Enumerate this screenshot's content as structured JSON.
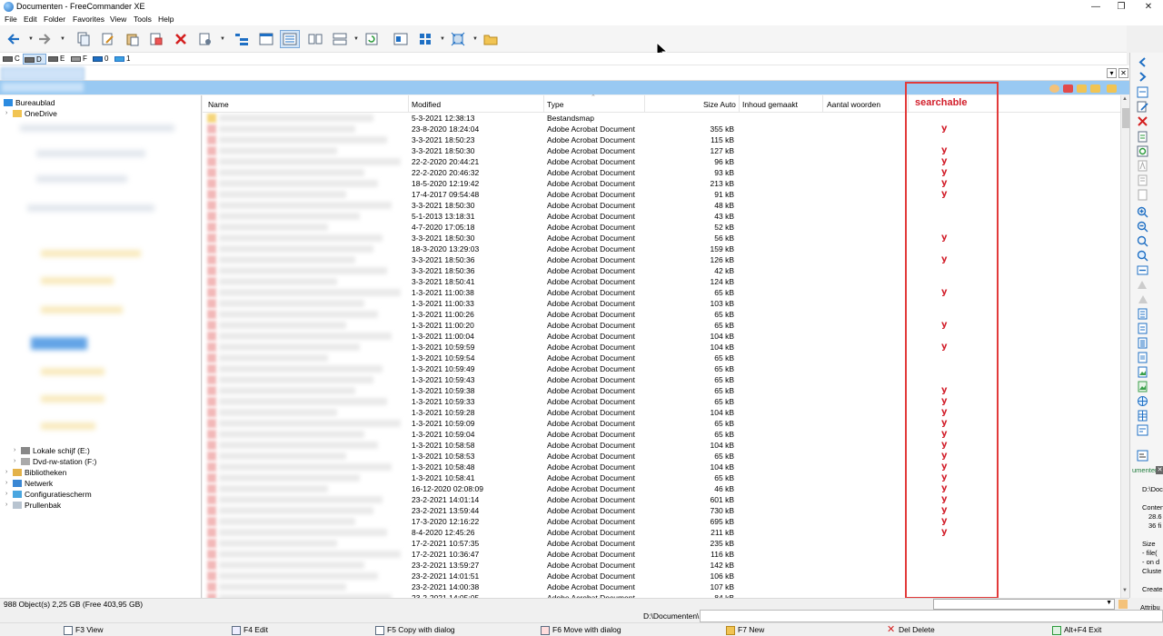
{
  "window": {
    "title": "Documenten - FreeCommander XE",
    "controls": [
      "—",
      "❐",
      "✕"
    ]
  },
  "menu": [
    "File",
    "Edit",
    "Folder",
    "Favorites",
    "View",
    "Tools",
    "Help"
  ],
  "drives": [
    {
      "label": "C",
      "selected": false
    },
    {
      "label": "D",
      "selected": true
    },
    {
      "label": "E",
      "selected": false
    },
    {
      "label": "F",
      "selected": false
    },
    {
      "label": "0",
      "selected": false
    },
    {
      "label": "1",
      "selected": false
    }
  ],
  "tree": {
    "top": [
      {
        "label": "Bureaublad",
        "icon": "desktop-icon"
      },
      {
        "label": "OneDrive",
        "icon": "folder-icon"
      }
    ],
    "bottom": [
      {
        "label": "Lokale schijf (E:)",
        "icon": "drive-icon"
      },
      {
        "label": "Dvd-rw-station (F:)",
        "icon": "dvd-drive-icon"
      },
      {
        "label": "Bibliotheken",
        "icon": "library-icon"
      },
      {
        "label": "Netwerk",
        "icon": "network-icon"
      },
      {
        "label": "Configuratiescherm",
        "icon": "control-panel-icon"
      },
      {
        "label": "Prullenbak",
        "icon": "recycle-bin-icon"
      }
    ]
  },
  "columns": {
    "name": "Name",
    "modified": "Modified",
    "type": "Type",
    "size": "Size Auto",
    "content_created": "Inhoud gemaakt",
    "word_count": "Aantal woorden"
  },
  "annotation": {
    "label": "searchable",
    "mark": "y",
    "color": "#d21f2b"
  },
  "files": [
    {
      "modified": "5-3-2021 12:38:13",
      "type": "Bestandsmap",
      "size": "",
      "folder": true,
      "searchable": false
    },
    {
      "modified": "23-8-2020 18:24:04",
      "type": "Adobe Acrobat Document",
      "size": "355 kB",
      "searchable": true
    },
    {
      "modified": "3-3-2021 18:50:23",
      "type": "Adobe Acrobat Document",
      "size": "115 kB",
      "searchable": false
    },
    {
      "modified": "3-3-2021 18:50:30",
      "type": "Adobe Acrobat Document",
      "size": "127 kB",
      "searchable": true
    },
    {
      "modified": "22-2-2020 20:44:21",
      "type": "Adobe Acrobat Document",
      "size": "96 kB",
      "searchable": true
    },
    {
      "modified": "22-2-2020 20:46:32",
      "type": "Adobe Acrobat Document",
      "size": "93 kB",
      "searchable": true
    },
    {
      "modified": "18-5-2020 12:19:42",
      "type": "Adobe Acrobat Document",
      "size": "213 kB",
      "searchable": true
    },
    {
      "modified": "17-4-2017 09:54:48",
      "type": "Adobe Acrobat Document",
      "size": "91 kB",
      "searchable": true
    },
    {
      "modified": "3-3-2021 18:50:30",
      "type": "Adobe Acrobat Document",
      "size": "48 kB",
      "searchable": false
    },
    {
      "modified": "5-1-2013 13:18:31",
      "type": "Adobe Acrobat Document",
      "size": "43 kB",
      "searchable": false
    },
    {
      "modified": "4-7-2020 17:05:18",
      "type": "Adobe Acrobat Document",
      "size": "52 kB",
      "searchable": false
    },
    {
      "modified": "3-3-2021 18:50:30",
      "type": "Adobe Acrobat Document",
      "size": "56 kB",
      "searchable": true
    },
    {
      "modified": "18-3-2020 13:29:03",
      "type": "Adobe Acrobat Document",
      "size": "159 kB",
      "searchable": false
    },
    {
      "modified": "3-3-2021 18:50:36",
      "type": "Adobe Acrobat Document",
      "size": "126 kB",
      "searchable": true
    },
    {
      "modified": "3-3-2021 18:50:36",
      "type": "Adobe Acrobat Document",
      "size": "42 kB",
      "searchable": false
    },
    {
      "modified": "3-3-2021 18:50:41",
      "type": "Adobe Acrobat Document",
      "size": "124 kB",
      "searchable": false
    },
    {
      "modified": "1-3-2021 11:00:38",
      "type": "Adobe Acrobat Document",
      "size": "65 kB",
      "searchable": true
    },
    {
      "modified": "1-3-2021 11:00:33",
      "type": "Adobe Acrobat Document",
      "size": "103 kB",
      "searchable": false
    },
    {
      "modified": "1-3-2021 11:00:26",
      "type": "Adobe Acrobat Document",
      "size": "65 kB",
      "searchable": false
    },
    {
      "modified": "1-3-2021 11:00:20",
      "type": "Adobe Acrobat Document",
      "size": "65 kB",
      "searchable": true
    },
    {
      "modified": "1-3-2021 11:00:04",
      "type": "Adobe Acrobat Document",
      "size": "104 kB",
      "searchable": false
    },
    {
      "modified": "1-3-2021 10:59:59",
      "type": "Adobe Acrobat Document",
      "size": "104 kB",
      "searchable": true
    },
    {
      "modified": "1-3-2021 10:59:54",
      "type": "Adobe Acrobat Document",
      "size": "65 kB",
      "searchable": false
    },
    {
      "modified": "1-3-2021 10:59:49",
      "type": "Adobe Acrobat Document",
      "size": "65 kB",
      "searchable": false
    },
    {
      "modified": "1-3-2021 10:59:43",
      "type": "Adobe Acrobat Document",
      "size": "65 kB",
      "searchable": false
    },
    {
      "modified": "1-3-2021 10:59:38",
      "type": "Adobe Acrobat Document",
      "size": "65 kB",
      "searchable": true
    },
    {
      "modified": "1-3-2021 10:59:33",
      "type": "Adobe Acrobat Document",
      "size": "65 kB",
      "searchable": true
    },
    {
      "modified": "1-3-2021 10:59:28",
      "type": "Adobe Acrobat Document",
      "size": "104 kB",
      "searchable": true
    },
    {
      "modified": "1-3-2021 10:59:09",
      "type": "Adobe Acrobat Document",
      "size": "65 kB",
      "searchable": true
    },
    {
      "modified": "1-3-2021 10:59:04",
      "type": "Adobe Acrobat Document",
      "size": "65 kB",
      "searchable": true
    },
    {
      "modified": "1-3-2021 10:58:58",
      "type": "Adobe Acrobat Document",
      "size": "104 kB",
      "searchable": true
    },
    {
      "modified": "1-3-2021 10:58:53",
      "type": "Adobe Acrobat Document",
      "size": "65 kB",
      "searchable": true
    },
    {
      "modified": "1-3-2021 10:58:48",
      "type": "Adobe Acrobat Document",
      "size": "104 kB",
      "searchable": true
    },
    {
      "modified": "1-3-2021 10:58:41",
      "type": "Adobe Acrobat Document",
      "size": "65 kB",
      "searchable": true
    },
    {
      "modified": "16-12-2020 02:08:09",
      "type": "Adobe Acrobat Document",
      "size": "46 kB",
      "searchable": true
    },
    {
      "modified": "23-2-2021 14:01:14",
      "type": "Adobe Acrobat Document",
      "size": "601 kB",
      "searchable": true
    },
    {
      "modified": "23-2-2021 13:59:44",
      "type": "Adobe Acrobat Document",
      "size": "730 kB",
      "searchable": true
    },
    {
      "modified": "17-3-2020 12:16:22",
      "type": "Adobe Acrobat Document",
      "size": "695 kB",
      "searchable": true
    },
    {
      "modified": "8-4-2020 12:45:26",
      "type": "Adobe Acrobat Document",
      "size": "211 kB",
      "searchable": true
    },
    {
      "modified": "17-2-2021 10:57:35",
      "type": "Adobe Acrobat Document",
      "size": "235 kB",
      "searchable": false
    },
    {
      "modified": "17-2-2021 10:36:47",
      "type": "Adobe Acrobat Document",
      "size": "116 kB",
      "searchable": false
    },
    {
      "modified": "23-2-2021 13:59:27",
      "type": "Adobe Acrobat Document",
      "size": "142 kB",
      "searchable": false
    },
    {
      "modified": "23-2-2021 14:01:51",
      "type": "Adobe Acrobat Document",
      "size": "106 kB",
      "searchable": false
    },
    {
      "modified": "23-2-2021 14:00:38",
      "type": "Adobe Acrobat Document",
      "size": "107 kB",
      "searchable": false
    },
    {
      "modified": "23-2-2021 14:05:05",
      "type": "Adobe Acrobat Document",
      "size": "84 kB",
      "searchable": false
    }
  ],
  "status": {
    "summary": "988 Object(s)   2,25 GB   (Free 403,95 GB)"
  },
  "commandline": {
    "path": "D:\\Documenten\\"
  },
  "right_panel": {
    "tab_label": "umenten",
    "path_text": "D:\\Doc",
    "content_lines": [
      "Conten",
      "28.6",
      "36 fi"
    ],
    "size_lines": [
      "Size",
      "- file(",
      "- on d",
      "Cluste"
    ],
    "created_label": "Create",
    "attrib_label": "Attribu"
  },
  "fkeys": [
    {
      "label": "F3 View",
      "icon": "view-icon"
    },
    {
      "label": "F4 Edit",
      "icon": "edit-icon"
    },
    {
      "label": "F5 Copy with dialog",
      "icon": "copy-icon"
    },
    {
      "label": "F6 Move with dialog",
      "icon": "move-icon"
    },
    {
      "label": "F7 New",
      "icon": "new-folder-icon"
    },
    {
      "label": "Del Delete",
      "icon": "delete-icon"
    },
    {
      "label": "Alt+F4 Exit",
      "icon": "exit-icon"
    }
  ]
}
